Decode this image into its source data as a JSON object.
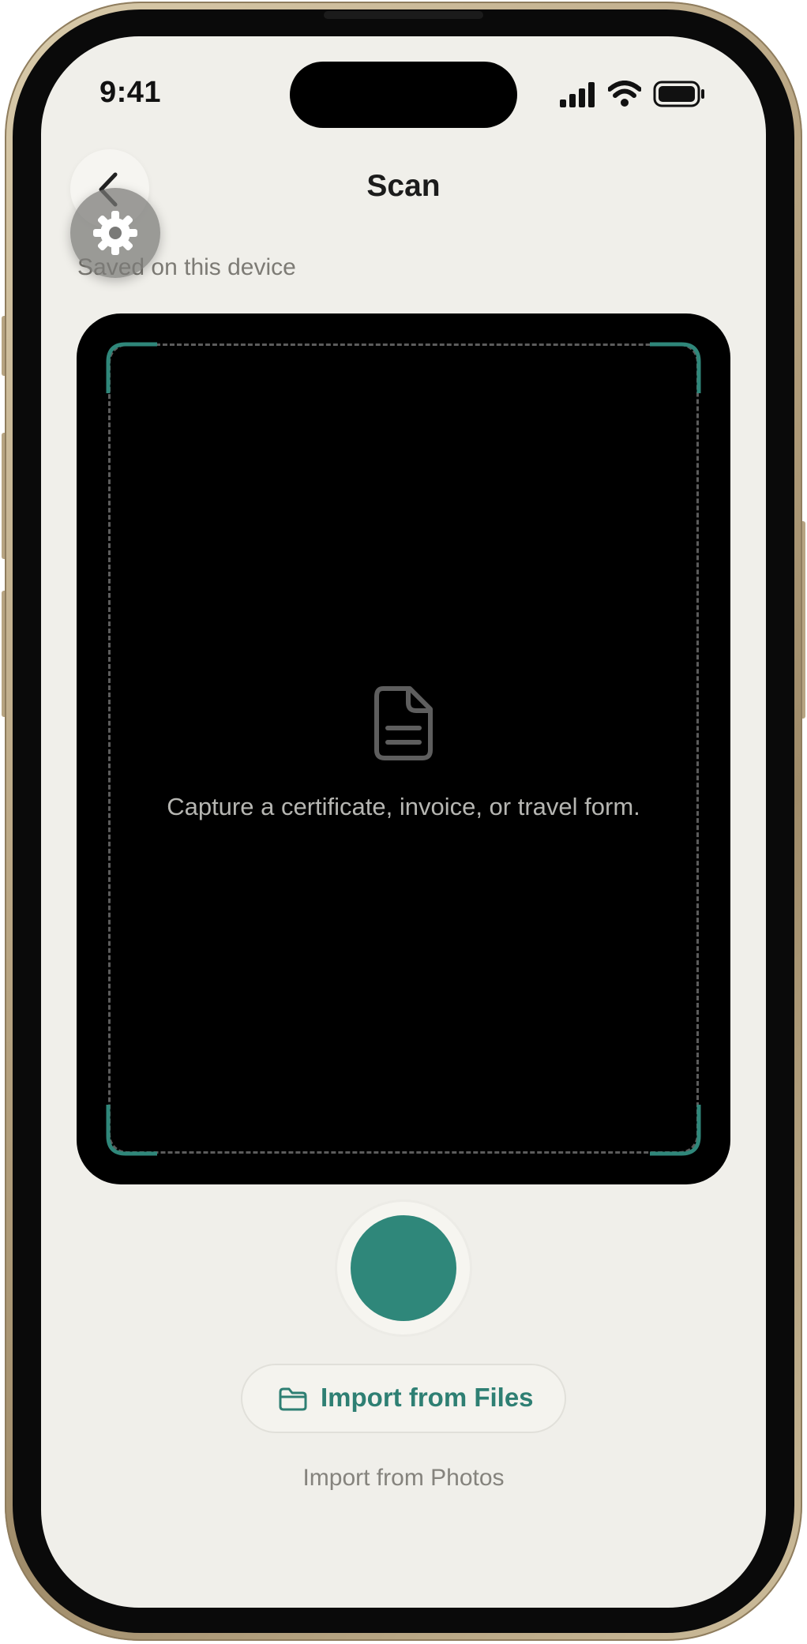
{
  "status_bar": {
    "time": "9:41"
  },
  "header": {
    "title": "Scan",
    "saved_note": "Saved on this device"
  },
  "viewfinder": {
    "caption": "Capture a certificate, invoice, or travel form."
  },
  "actions": {
    "import_files_label": "Import from Files",
    "import_photos_label": "Import from Photos"
  },
  "icons": {
    "back": "chevron-left-icon",
    "settings": "gear-icon",
    "document": "document-icon",
    "folder": "folder-icon",
    "signal": "cellular-signal-icon",
    "wifi": "wifi-icon",
    "battery": "battery-icon"
  },
  "colors": {
    "accent": "#2f877a",
    "background": "#f0efea",
    "viewfinder": "#000000"
  }
}
